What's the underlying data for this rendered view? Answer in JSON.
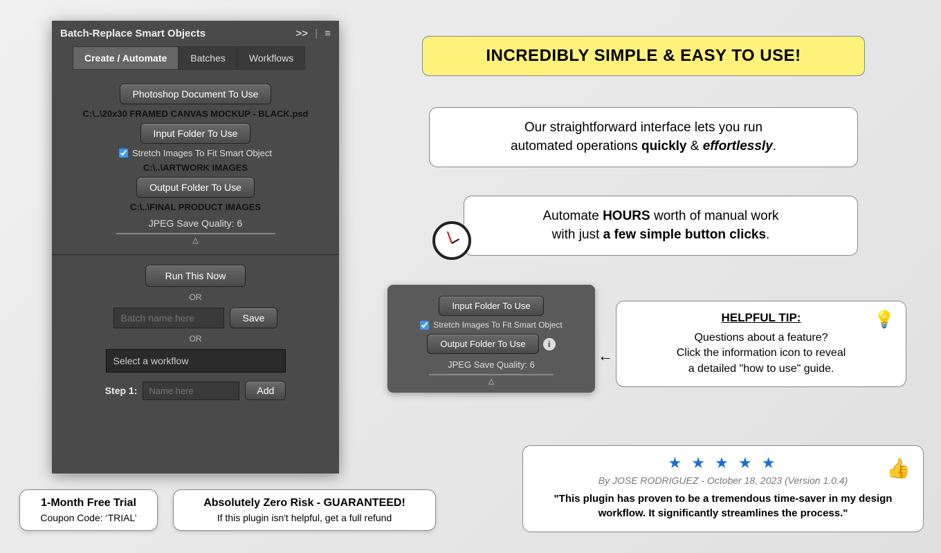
{
  "panel": {
    "title": "Batch-Replace Smart Objects",
    "collapse_icon": ">>",
    "menu_icon": "≡",
    "tabs": [
      "Create / Automate",
      "Batches",
      "Workflows"
    ],
    "active_tab": 0,
    "doc_button": "Photoshop Document To Use",
    "doc_path": "C:\\..\\20x30 FRAMED CANVAS MOCKUP - BLACK.psd",
    "input_button": "Input Folder To Use",
    "stretch_label": "Stretch Images To Fit Smart Object",
    "stretch_checked": true,
    "input_path": "C:\\..\\ARTWORK IMAGES",
    "output_button": "Output Folder To Use",
    "output_path": "C:\\..\\FINAL PRODUCT IMAGES",
    "jpeg_label": "JPEG Save Quality: 6",
    "slider_indicator": "△",
    "run_button": "Run This Now",
    "or_text": "OR",
    "batch_placeholder": "Batch name here",
    "save_button": "Save",
    "workflow_placeholder": "Select a workflow",
    "step_label": "Step 1:",
    "step_placeholder": "Name here",
    "add_button": "Add"
  },
  "bottom_left": {
    "trial_title": "1-Month Free Trial",
    "trial_sub": "Coupon Code: ‘TRIAL’",
    "risk_title": "Absolutely Zero Risk - GUARANTEED!",
    "risk_sub": "If this plugin isn't helpful, get a full refund"
  },
  "headline": "INCREDIBLY SIMPLE & EASY TO USE!",
  "promo1_a": "Our straightforward interface lets you run",
  "promo1_b": "automated operations ",
  "promo1_c": "quickly",
  "promo1_d": " & ",
  "promo1_e": "effortlessly",
  "promo2_a": "Automate ",
  "promo2_b": "HOURS",
  "promo2_c": " worth of manual work",
  "promo2_d": "with just ",
  "promo2_e": "a few simple button clicks",
  "mini": {
    "input_button": "Input Folder To Use",
    "stretch_label": "Stretch Images To Fit Smart Object",
    "output_button": "Output Folder To Use",
    "info_glyph": "i",
    "jpeg_label": "JPEG Save Quality: 6",
    "indicator": "△"
  },
  "arrow_glyph": "←",
  "tip": {
    "title": "HELPFUL TIP:",
    "line1": "Questions about a feature?",
    "line2": "Click the information icon to reveal",
    "line3": "a detailed \"how to use\" guide.",
    "bulb": "💡"
  },
  "review": {
    "stars": "★ ★ ★ ★ ★",
    "byline": "By JOSE RODRIGUEZ - October 18, 2023 (Version 1.0.4)",
    "quote": "\"This plugin has proven to be a tremendous time-saver in my design workflow. It significantly streamlines the process.\"",
    "thumb": "👍"
  }
}
